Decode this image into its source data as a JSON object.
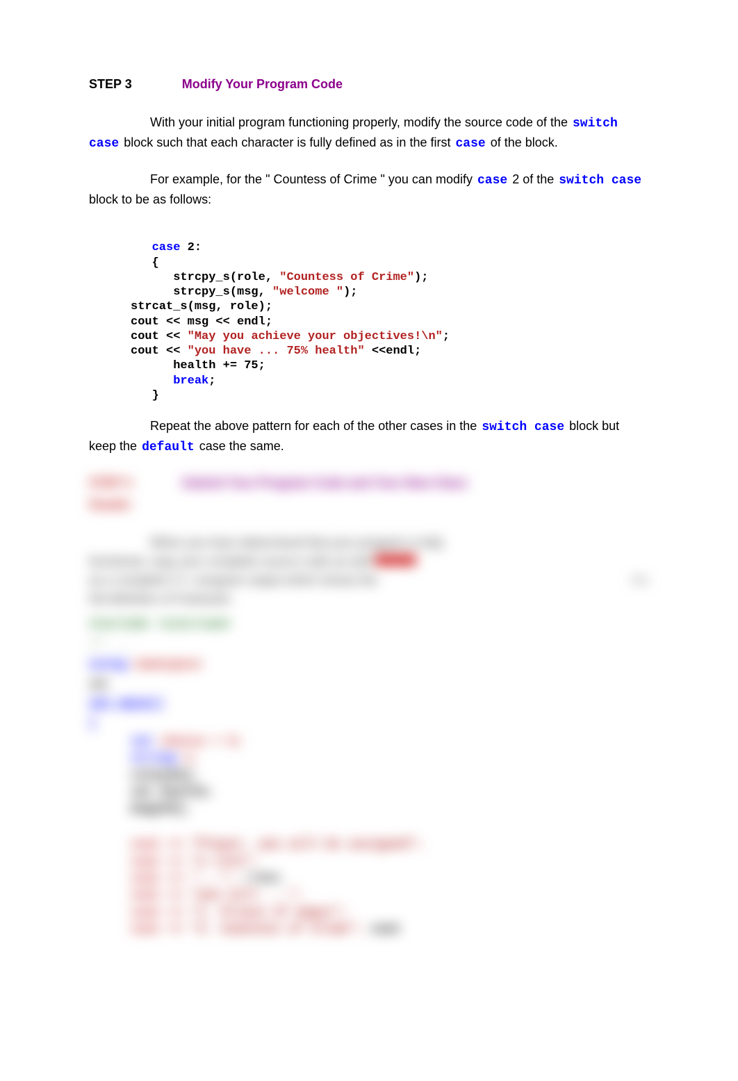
{
  "step": {
    "label": "STEP 3",
    "title": "Modify Your Program Code"
  },
  "para1": {
    "t1": "With your initial program functioning properly, modify the source code of the ",
    "kw1": "switch case",
    "t2": " block such that each character is fully defined as in the first ",
    "kw2": "case",
    "t3": " of the block."
  },
  "para2": {
    "t1": "For example, for the \" Countess of Crime \" you can modify ",
    "kw1": "case",
    "t2": " 2 of the ",
    "kw2": "switch case",
    "t3": " block to be as follows:"
  },
  "code": {
    "l1a": "case",
    "l1b": " 2:",
    "l2": "{",
    "l3a": "   strcpy_s(role, ",
    "l3s": "\"Countess of Crime\"",
    "l3b": ");",
    "l4a": "   strcpy_s(msg, ",
    "l4s": "\"welcome \"",
    "l4b": ");",
    "l5": "strcat_s(msg, role);",
    "l6": "cout << msg << endl;",
    "l7a": "cout << ",
    "l7s": "\"May you achieve your objectives!\\n\"",
    "l7b": ";",
    "l8a": "cout << ",
    "l8s": "\"you have ... 75% health\"",
    "l8b": " <<endl;",
    "l9": "   health += 75;",
    "l10a": "   ",
    "l10kw": "break",
    "l10b": ";",
    "l11": "}"
  },
  "para3": {
    "t1": "Repeat the above pattern for each of the other cases in the ",
    "kw1": "switch case",
    "t2": " block but keep the ",
    "kw2": "default",
    "t3": " case the same."
  },
  "blurred": {
    "step_label": "STEP 4",
    "step_title": "Submit Your Program Code and Your New Class",
    "sub": "Header",
    "p1": "When you have determined that your program is fully",
    "p2": "functional, copy your complete source code as well",
    "p3": "as a complete C++ program output which shows the",
    "p4": "full definition of Character."
  }
}
